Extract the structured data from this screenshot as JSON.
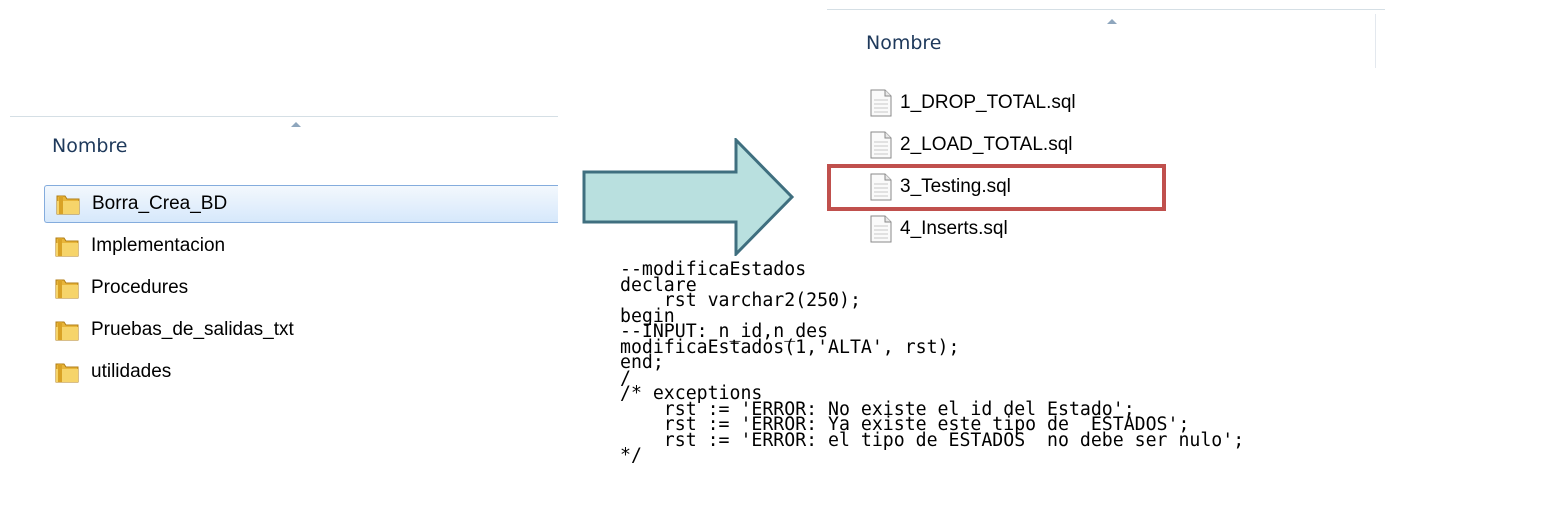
{
  "left_panel": {
    "column_header": "Nombre",
    "items": [
      {
        "label": "Borra_Crea_BD",
        "icon": "folder-icon",
        "selected": true
      },
      {
        "label": "Implementacion",
        "icon": "folder-icon",
        "selected": false
      },
      {
        "label": "Procedures",
        "icon": "folder-icon",
        "selected": false
      },
      {
        "label": "Pruebas_de_salidas_txt",
        "icon": "folder-icon",
        "selected": false
      },
      {
        "label": "utilidades",
        "icon": "folder-icon",
        "selected": false
      }
    ]
  },
  "arrow": {
    "icon": "right-arrow-icon",
    "fill_color": "#b9e0df",
    "stroke_color": "#3f6f7f"
  },
  "right_panel": {
    "column_header": "Nombre",
    "items": [
      {
        "label": "1_DROP_TOTAL.sql",
        "icon": "sql-file-icon"
      },
      {
        "label": "2_LOAD_TOTAL.sql",
        "icon": "sql-file-icon"
      },
      {
        "label": "3_Testing.sql",
        "icon": "sql-file-icon",
        "highlighted": true
      },
      {
        "label": "4_Inserts.sql",
        "icon": "sql-file-icon"
      }
    ],
    "highlight_color": "#c0504d"
  },
  "code": {
    "lines": [
      "--modificaEstados",
      "declare",
      "    rst varchar2(250);",
      "begin",
      "--INPUT: n_id,n_des",
      "modificaEstados(1,'ALTA', rst);",
      "end;",
      "/",
      "/* exceptions",
      "    rst := 'ERROR: No existe el id del Estado';",
      "    rst := 'ERROR: Ya existe este tipo de  ESTADOS';",
      "    rst := 'ERROR: el tipo de ESTADOS  no debe ser nulo';",
      "*/"
    ]
  }
}
